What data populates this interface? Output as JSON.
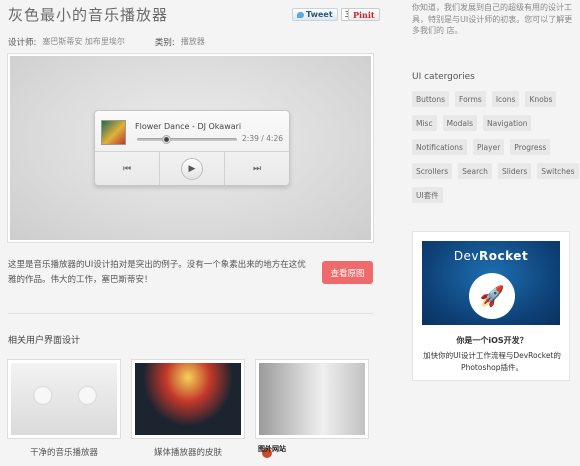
{
  "header": {
    "title": "灰色最小的音乐播放器",
    "tweet_label": "Tweet",
    "tweet_count": "3",
    "pin_label": "Pinit"
  },
  "meta": {
    "designer_label": "设计师:",
    "designer_value": "塞巴斯蒂安 加布里埃尔",
    "category_label": "类别:",
    "category_value": "播放器"
  },
  "player": {
    "song": "Flower Dance - DJ Okawari",
    "time": "2:39 / 4:26",
    "progress_fraction": 0.29,
    "prev_icon": "⏮",
    "play_icon": "▶",
    "next_icon": "⏭"
  },
  "description": "这里是音乐播放器的UI设计拍对是突出的例子。没有一个象素出来的地方在这优雅的作品。伟大的工作，塞巴斯蒂安！",
  "view_button": "查看原图",
  "related": {
    "heading": "相关用户界面设计",
    "items": [
      {
        "caption": "干净的音乐播放器"
      },
      {
        "caption": "媒体播放器的皮肤"
      },
      {
        "caption": ""
      }
    ]
  },
  "watermark": "图外网站",
  "sidebar": {
    "intro": "你知道，我们发展到自己的超级有用的设计工具，特别是与UI设计师的初衷。您可以了解更多我们的 店。",
    "categories_heading": "UI catergories",
    "tags": [
      "Buttons",
      "Forms",
      "Icons",
      "Knobs",
      "Misc",
      "Modals",
      "Navigation",
      "Notifications",
      "Player",
      "Progress",
      "Scrollers",
      "Search",
      "Sliders",
      "Switches",
      "UI套件"
    ],
    "ad": {
      "brand_prefix": "Dev",
      "brand_suffix": "Rocket",
      "question": "你是一个iOS开发？",
      "text": "加快你的UI设计工作流程与DevRocket的Photoshop插件。"
    }
  },
  "colors": {
    "accent_button": "#ef6b6b",
    "ad_blue": "#0d3f75"
  }
}
